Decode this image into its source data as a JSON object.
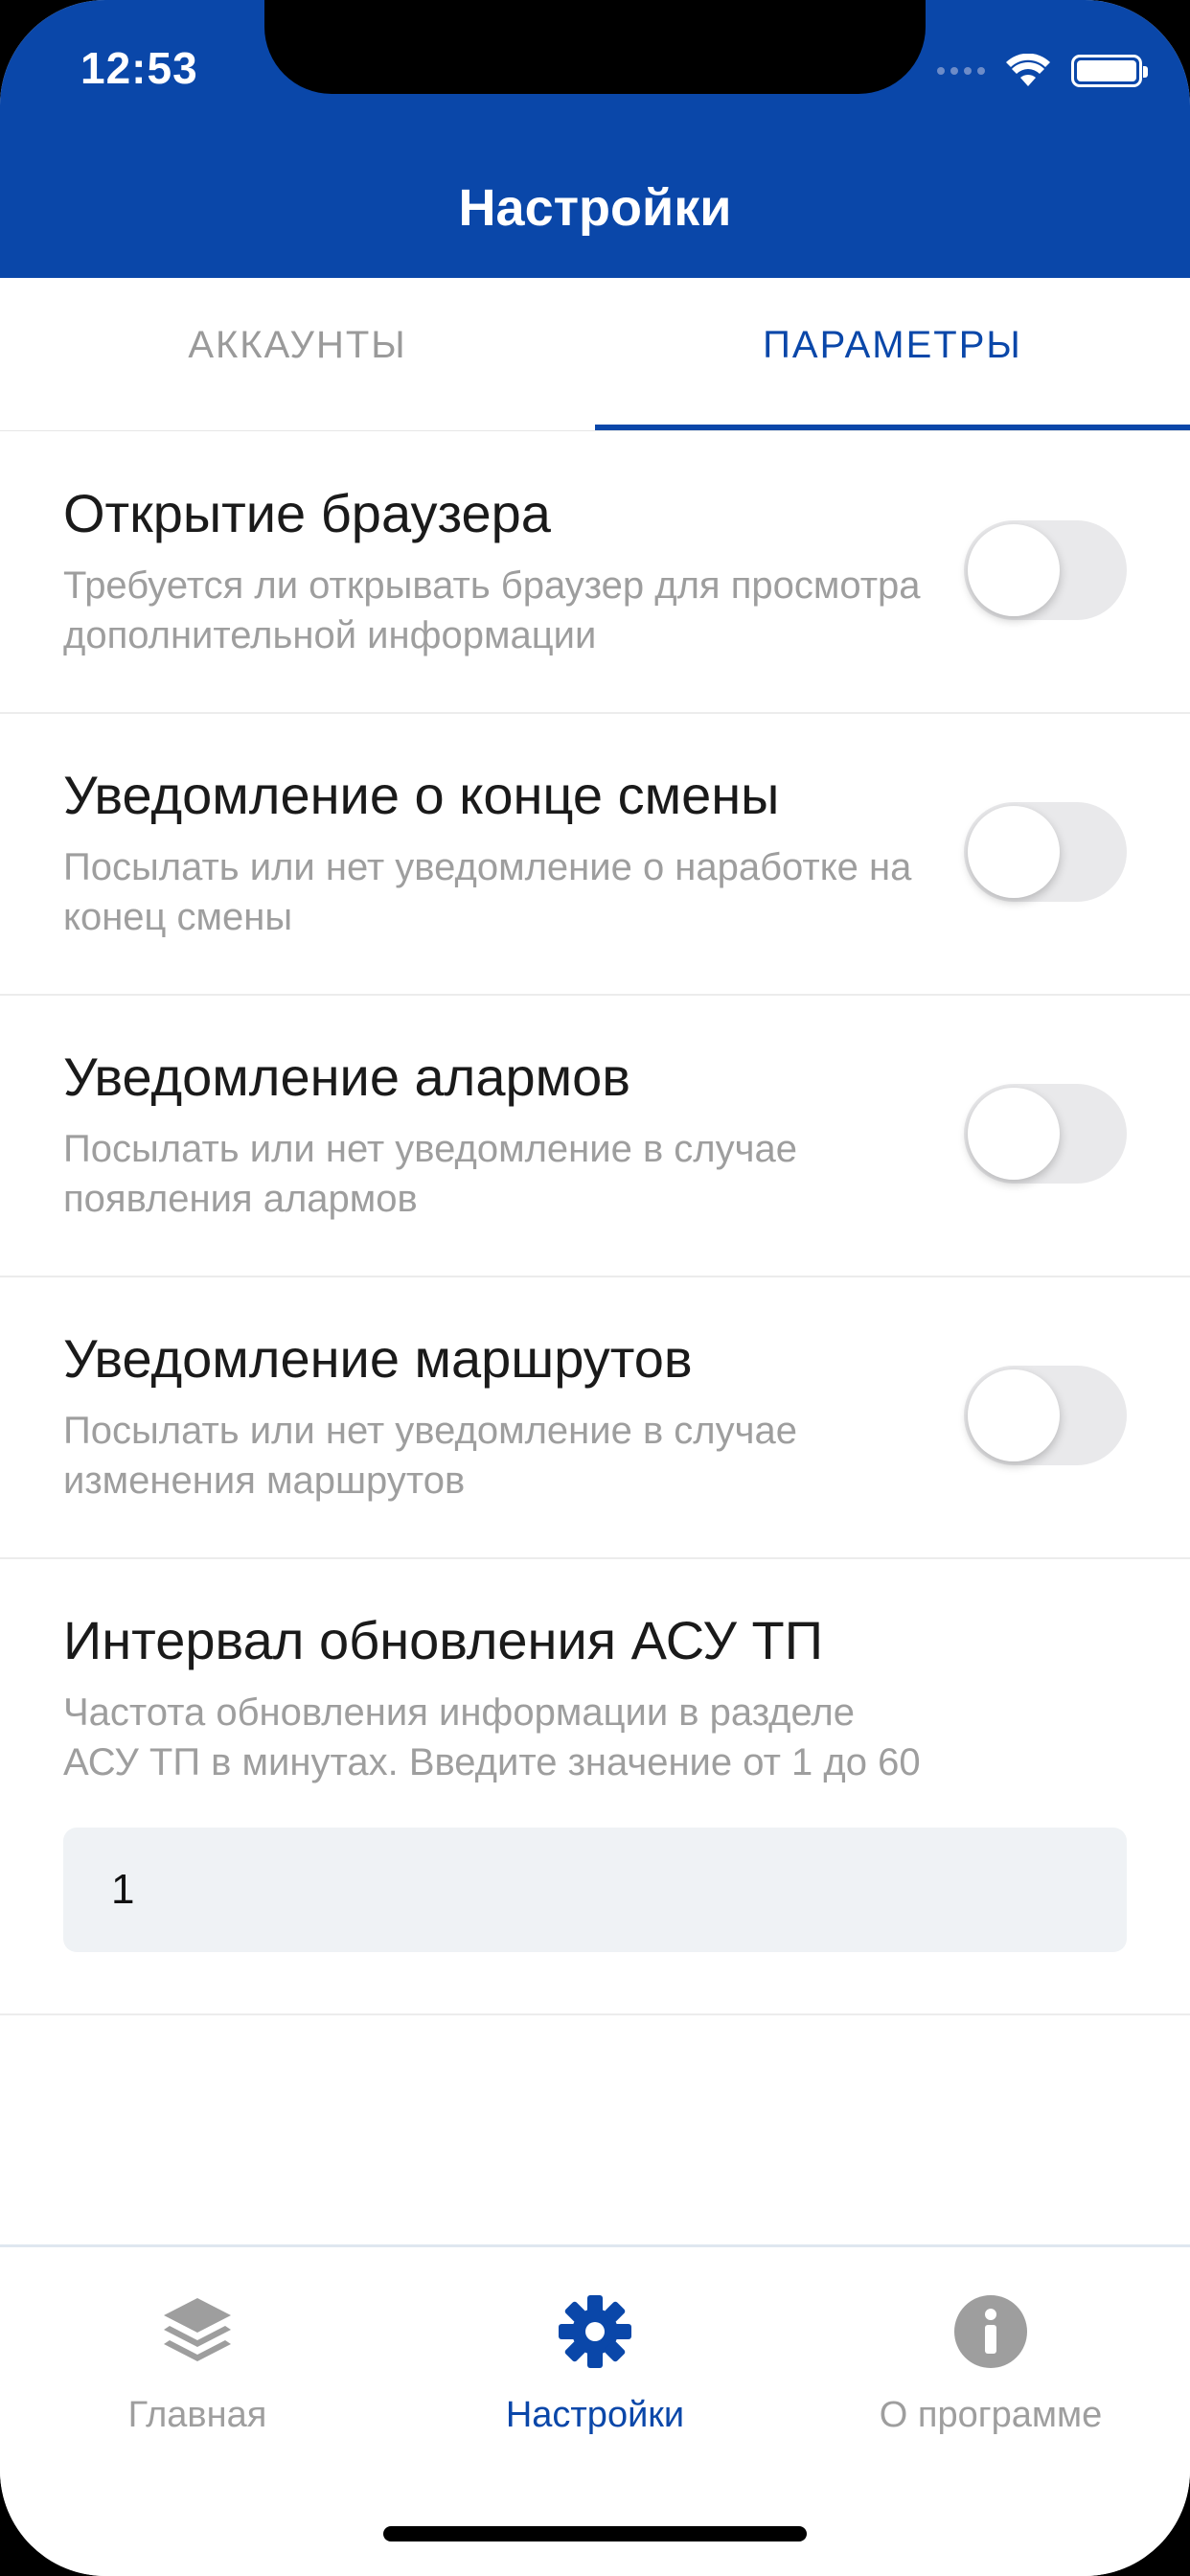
{
  "status_bar": {
    "time": "12:53"
  },
  "header": {
    "title": "Настройки"
  },
  "tabs": [
    {
      "label": "АККАУНТЫ",
      "active": false
    },
    {
      "label": "ПАРАМЕТРЫ",
      "active": true
    }
  ],
  "settings": [
    {
      "title": "Открытие браузера",
      "description": "Требуется ли открывать браузер для просмотра дополнительной информации",
      "enabled": false
    },
    {
      "title": "Уведомление о конце смены",
      "description": "Посылать или нет уведомление о наработке на конец смены",
      "enabled": false
    },
    {
      "title": "Уведомление алармов",
      "description": "Посылать или нет уведомление в случае появления алармов",
      "enabled": false
    },
    {
      "title": "Уведомление маршрутов",
      "description": "Посылать или нет уведомление в случае изменения маршрутов",
      "enabled": false
    }
  ],
  "interval": {
    "title": "Интервал обновления АСУ ТП",
    "description": "Частота обновления информации в разделе АСУ ТП в минутах. Введите значение от 1 до 60",
    "value": "1"
  },
  "bottom_nav": [
    {
      "label": "Главная",
      "icon": "layers-icon",
      "active": false
    },
    {
      "label": "Настройки",
      "icon": "gear-icon",
      "active": true
    },
    {
      "label": "О программе",
      "icon": "info-icon",
      "active": false
    }
  ],
  "colors": {
    "accent": "#0a47a9",
    "inactive": "#9e9e9e",
    "toggle_off": "#e9e9eb",
    "input_bg": "#eff2f5"
  }
}
